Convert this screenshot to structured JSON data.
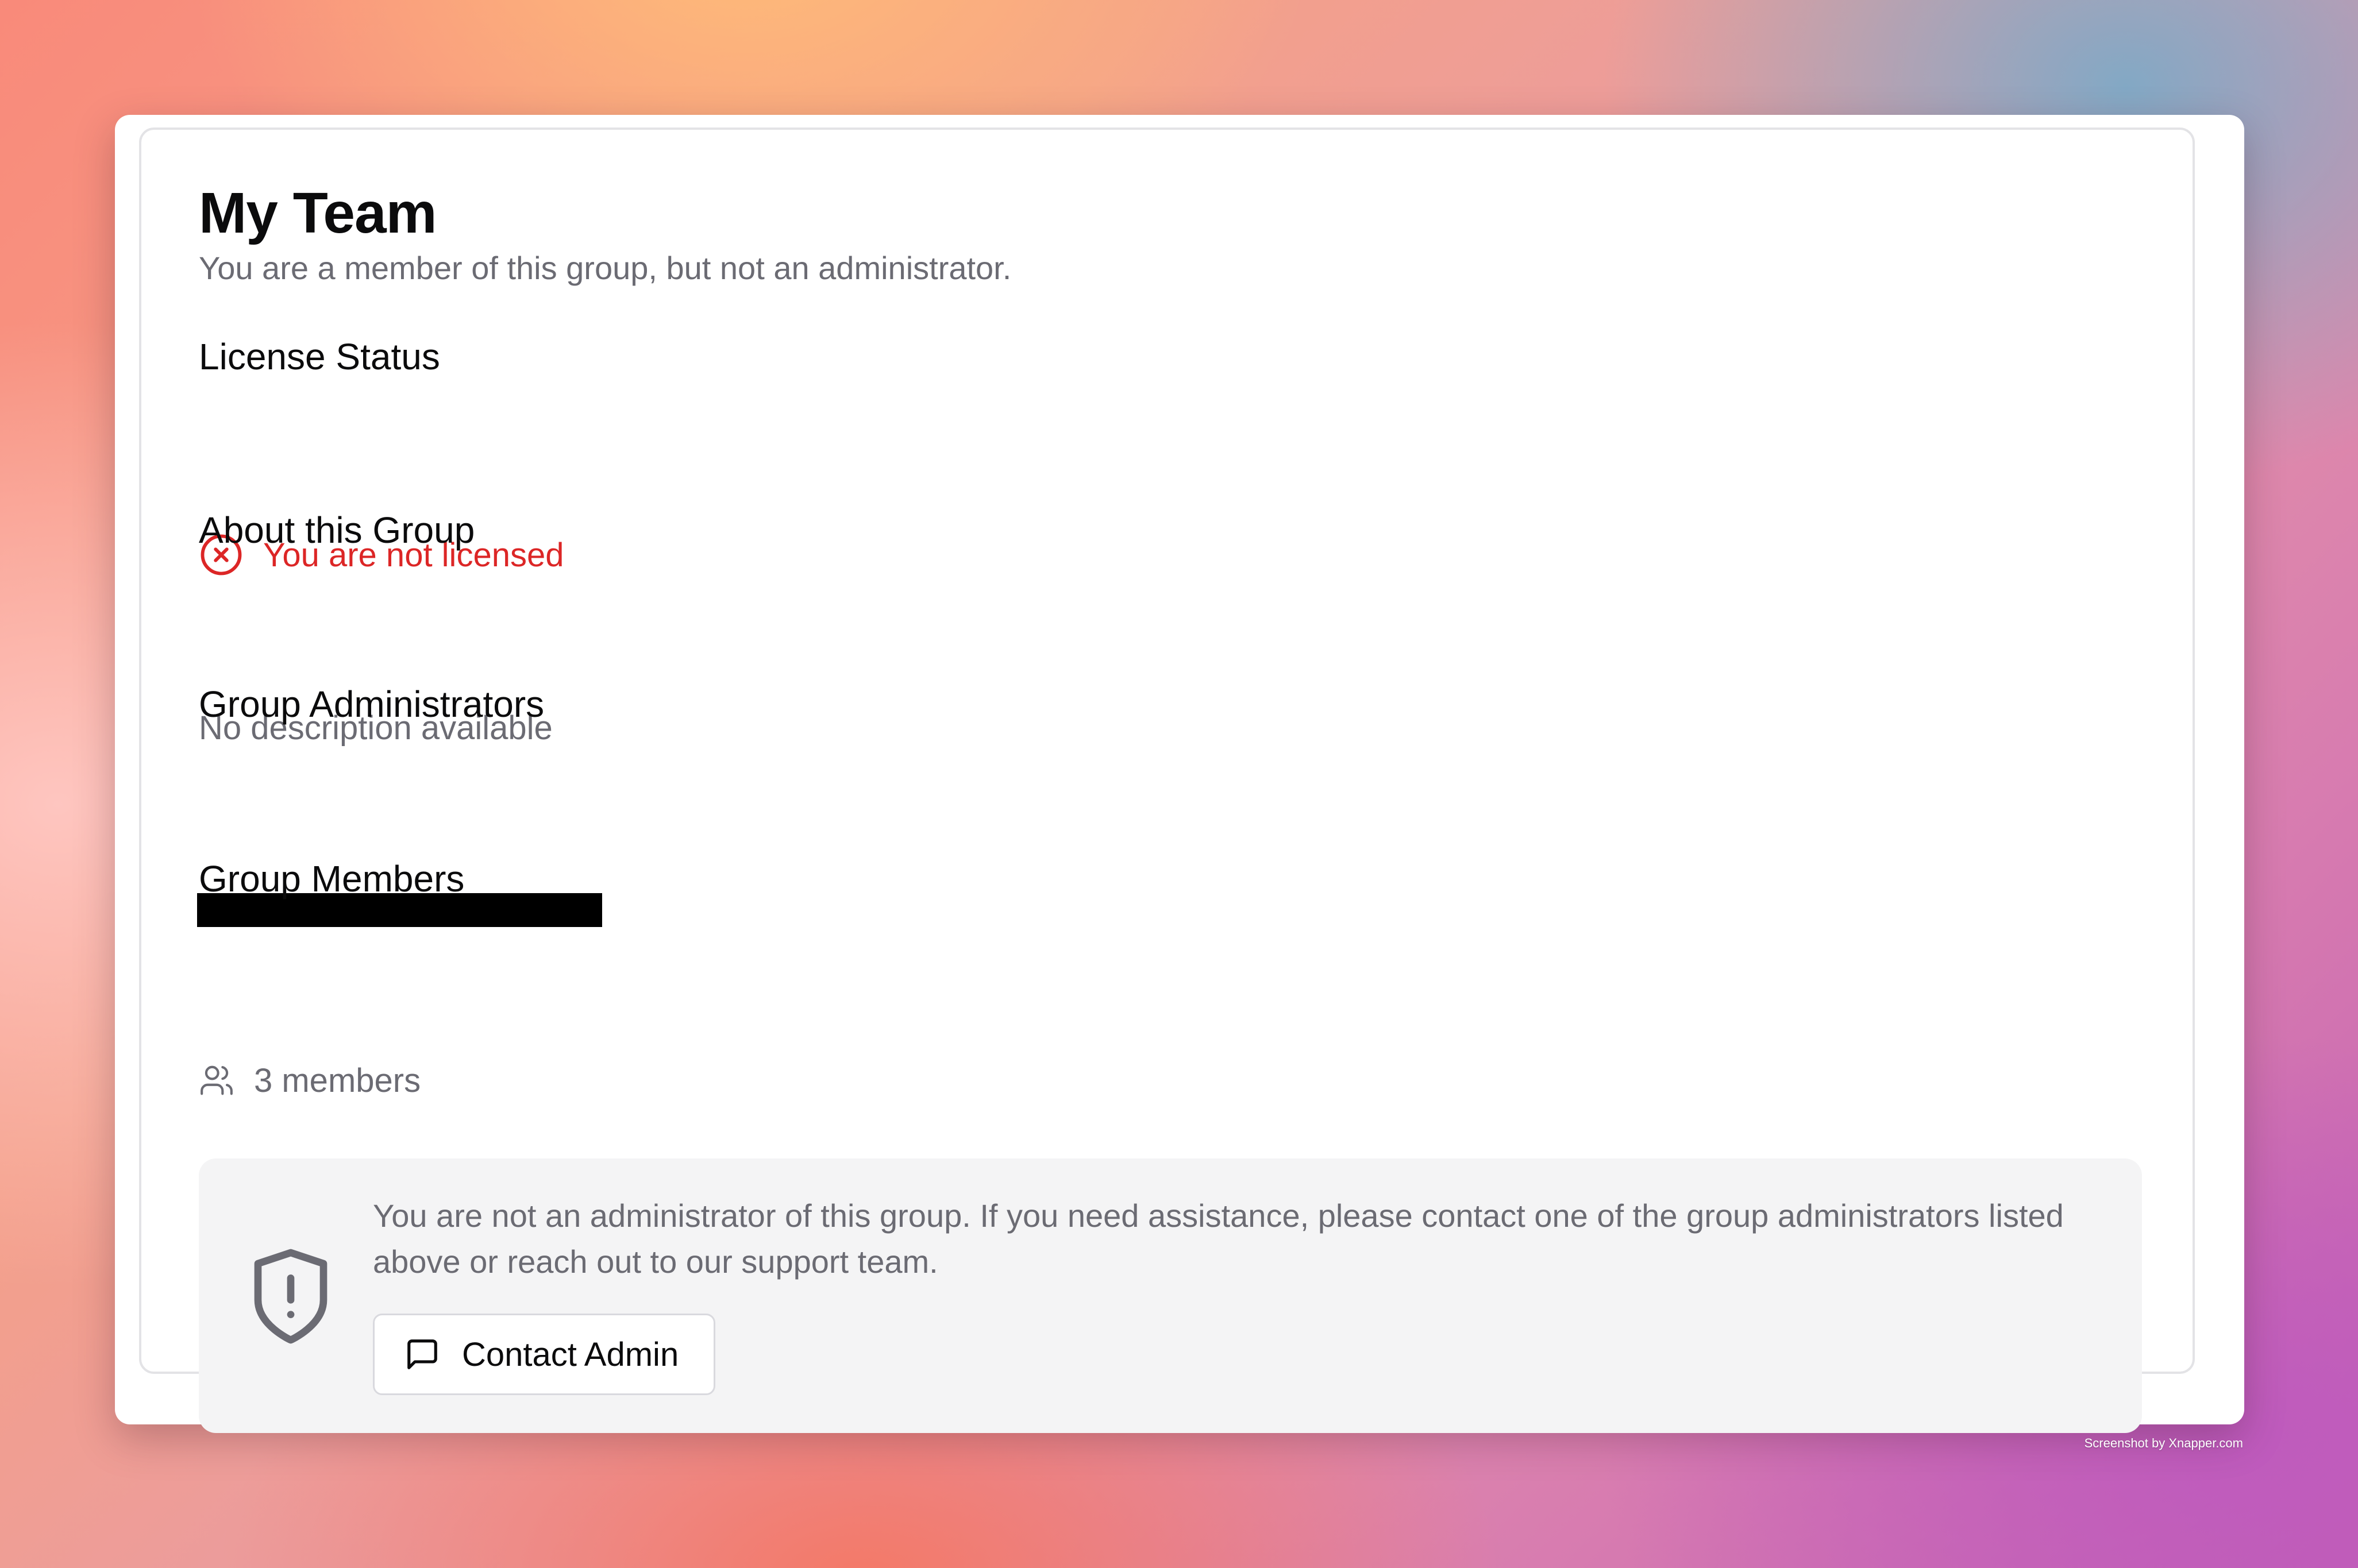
{
  "page": {
    "title": "My Team",
    "subtitle": "You are a member of this group, but not an administrator."
  },
  "license": {
    "heading": "License Status",
    "status_icon": "x-circle-icon",
    "status_text": "You are not licensed",
    "status_color": "#dc2626"
  },
  "about": {
    "heading": "About this Group",
    "description": "No description available"
  },
  "administrators": {
    "heading": "Group Administrators"
  },
  "members": {
    "heading": "Group Members",
    "icon": "users-icon",
    "count_text": "3 members"
  },
  "notice": {
    "icon": "shield-alert-icon",
    "text": "You are not an administrator of this group. If you need assistance, please contact one of the group administrators listed above or reach out to our support team.",
    "button_icon": "message-square-icon",
    "button_label": "Contact Admin"
  },
  "watermark": "Screenshot by Xnapper.com"
}
